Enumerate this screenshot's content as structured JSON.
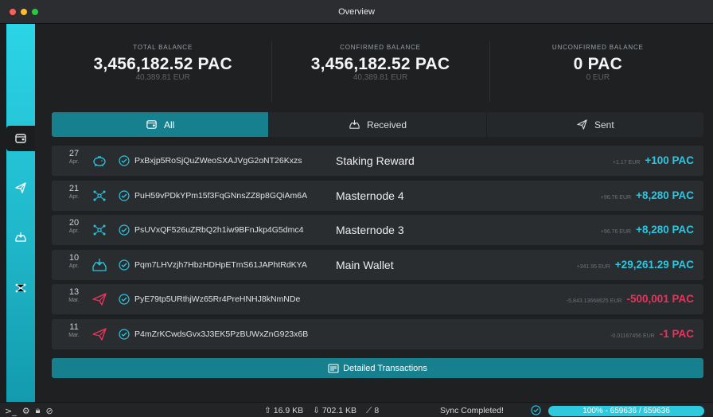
{
  "window": {
    "title": "Overview"
  },
  "balances": [
    {
      "label": "TOTAL BALANCE",
      "value": "3,456,182.52 PAC",
      "fiat": "40,389.81 EUR"
    },
    {
      "label": "CONFIRMED BALANCE",
      "value": "3,456,182.52 PAC",
      "fiat": "40,389.81 EUR"
    },
    {
      "label": "UNCONFIRMED BALANCE",
      "value": "0 PAC",
      "fiat": "0 EUR"
    }
  ],
  "tabs": [
    {
      "label": "All",
      "icon": "wallet-icon",
      "active": true
    },
    {
      "label": "Received",
      "icon": "inbox-icon",
      "active": false
    },
    {
      "label": "Sent",
      "icon": "send-icon",
      "active": false
    }
  ],
  "transactions": [
    {
      "day": "27",
      "month": "Apr.",
      "type": "staking",
      "address": "PxBxjp5RoSjQuZWeoSXAJVgG2oNT26Kxzs",
      "label": "Staking Reward",
      "fiat": "+1.17 EUR",
      "amount": "+100 PAC",
      "direction": "in"
    },
    {
      "day": "21",
      "month": "Apr.",
      "type": "masternode",
      "address": "PuH59vPDkYPm15f3FqGNnsZZ8p8GQiAm6A",
      "label": "Masternode 4",
      "fiat": "+96.76 EUR",
      "amount": "+8,280 PAC",
      "direction": "in"
    },
    {
      "day": "20",
      "month": "Apr.",
      "type": "masternode",
      "address": "PsUVxQF526uZRbQ2h1iw9BFnJkp4G5dmc4",
      "label": "Masternode 3",
      "fiat": "+96.76 EUR",
      "amount": "+8,280 PAC",
      "direction": "in"
    },
    {
      "day": "10",
      "month": "Apr.",
      "type": "received",
      "address": "Pqm7LHVzjh7HbzHDHpETmS61JAPhtRdKYA",
      "label": "Main Wallet",
      "fiat": "+341.95 EUR",
      "amount": "+29,261.29 PAC",
      "direction": "in"
    },
    {
      "day": "13",
      "month": "Mar.",
      "type": "sent",
      "address": "PyE79tp5URthjWz65Rr4PreHNHJ8kNmNDe",
      "label": "",
      "fiat": "-5,843.13668625 EUR",
      "amount": "-500,001 PAC",
      "direction": "out"
    },
    {
      "day": "11",
      "month": "Mar.",
      "type": "sent",
      "address": "P4mZrKCwdsGvx3J3EK5PzBUWxZnG923x6B",
      "label": "",
      "fiat": "-0.01167456 EUR",
      "amount": "-1 PAC",
      "direction": "out"
    }
  ],
  "detail_button": {
    "label": "Detailed Transactions"
  },
  "status": {
    "upload": "16.9 KB",
    "download": "702.1 KB",
    "peers": "8",
    "sync_text": "Sync Completed!",
    "progress_label": "100% - 659636 / 659636",
    "progress_fraction": 1.0
  },
  "colors": {
    "accent": "#2bd4e6",
    "tab_active": "#17808f",
    "incoming": "#2bc6e0",
    "outgoing": "#e8335c"
  }
}
